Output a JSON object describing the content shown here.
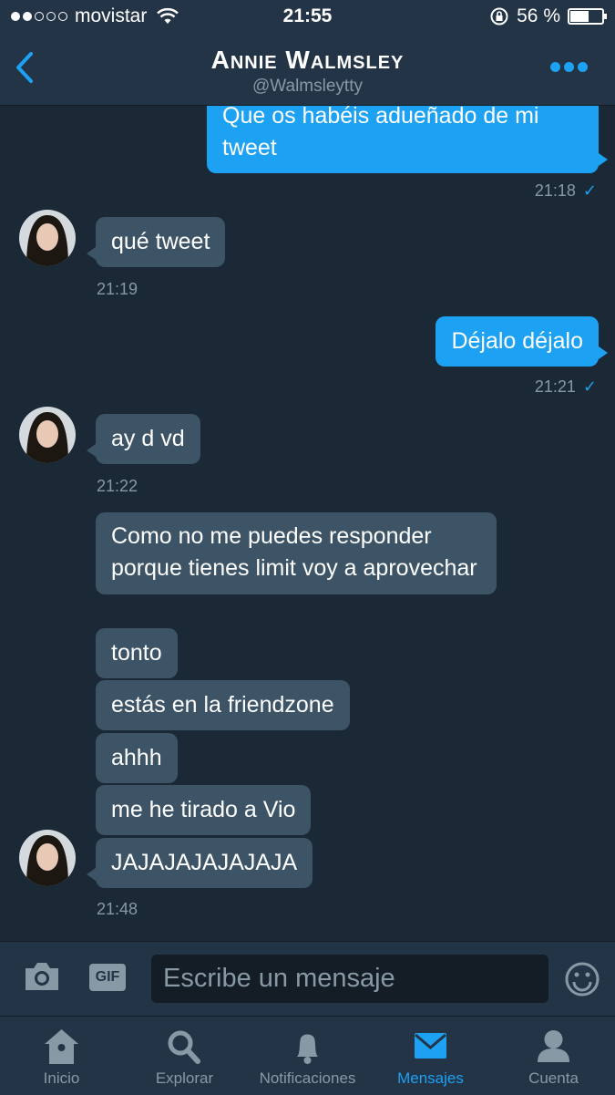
{
  "status": {
    "carrier": "movistar",
    "time": "21:55",
    "battery": "56 %"
  },
  "header": {
    "name": "Annie Walmsley",
    "handle": "@Walmsleytty"
  },
  "messages": [
    {
      "dir": "out",
      "text": "Que os habéis adueñado de mi tweet",
      "time": "21:18",
      "read": true
    },
    {
      "dir": "in",
      "text": "qué tweet",
      "time": "21:19"
    },
    {
      "dir": "out",
      "text": "Déjalo déjalo",
      "time": "21:21",
      "read": true
    },
    {
      "dir": "in",
      "text": "ay d vd",
      "time": "21:22"
    },
    {
      "dir": "in",
      "text": "Como no me puedes responder porque tienes limit voy a aprovechar"
    },
    {
      "dir": "in",
      "text": "tonto"
    },
    {
      "dir": "in",
      "text": "estás en la friendzone"
    },
    {
      "dir": "in",
      "text": "ahhh"
    },
    {
      "dir": "in",
      "text": "me he tirado a Vio"
    },
    {
      "dir": "in",
      "text": "JAJAJAJAJAJAJA",
      "time": "21:48"
    }
  ],
  "composer": {
    "placeholder": "Escribe un mensaje",
    "gif_label": "GIF"
  },
  "tabs": [
    {
      "label": "Inicio",
      "icon": "home-icon"
    },
    {
      "label": "Explorar",
      "icon": "search-icon"
    },
    {
      "label": "Notificaciones",
      "icon": "bell-icon"
    },
    {
      "label": "Mensajes",
      "icon": "envelope-icon",
      "active": true
    },
    {
      "label": "Cuenta",
      "icon": "person-icon"
    }
  ],
  "colors": {
    "accent": "#1da1f2",
    "background": "#1b2836",
    "bar": "#243447",
    "incoming": "#3d5466",
    "muted": "#8899a6"
  }
}
